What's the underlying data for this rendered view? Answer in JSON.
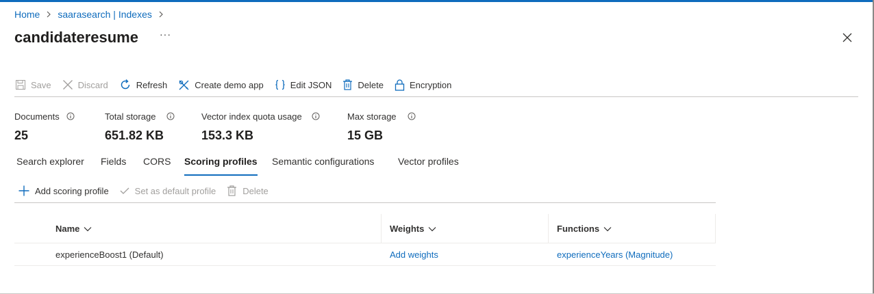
{
  "breadcrumb": {
    "home": "Home",
    "service": "saarasearch | Indexes"
  },
  "page": {
    "title": "candidateresume",
    "more": "···"
  },
  "toolbar": {
    "save": "Save",
    "discard": "Discard",
    "refresh": "Refresh",
    "create_demo_app": "Create demo app",
    "edit_json": "Edit JSON",
    "delete": "Delete",
    "encryption": "Encryption"
  },
  "stats": [
    {
      "label": "Documents",
      "value": "25"
    },
    {
      "label": "Total storage",
      "value": "651.82 KB"
    },
    {
      "label": "Vector index quota usage",
      "value": "153.3 KB"
    },
    {
      "label": "Max storage",
      "value": "15 GB"
    }
  ],
  "tabs": [
    {
      "label": "Search explorer"
    },
    {
      "label": "Fields"
    },
    {
      "label": "CORS"
    },
    {
      "label": "Scoring profiles",
      "active": true
    },
    {
      "label": "Semantic configurations"
    },
    {
      "label": "Vector profiles"
    }
  ],
  "subtoolbar": {
    "add": "Add scoring profile",
    "set_default": "Set as default profile",
    "delete": "Delete"
  },
  "grid": {
    "columns": [
      "Name",
      "Weights",
      "Functions"
    ],
    "rows": [
      {
        "name": "experienceBoost1 (Default)",
        "weights": "Add weights",
        "functions": "experienceYears (Magnitude)"
      }
    ]
  },
  "colors": {
    "accent": "#0f6cbd",
    "text": "#323130",
    "disabled": "#a19f9d"
  }
}
